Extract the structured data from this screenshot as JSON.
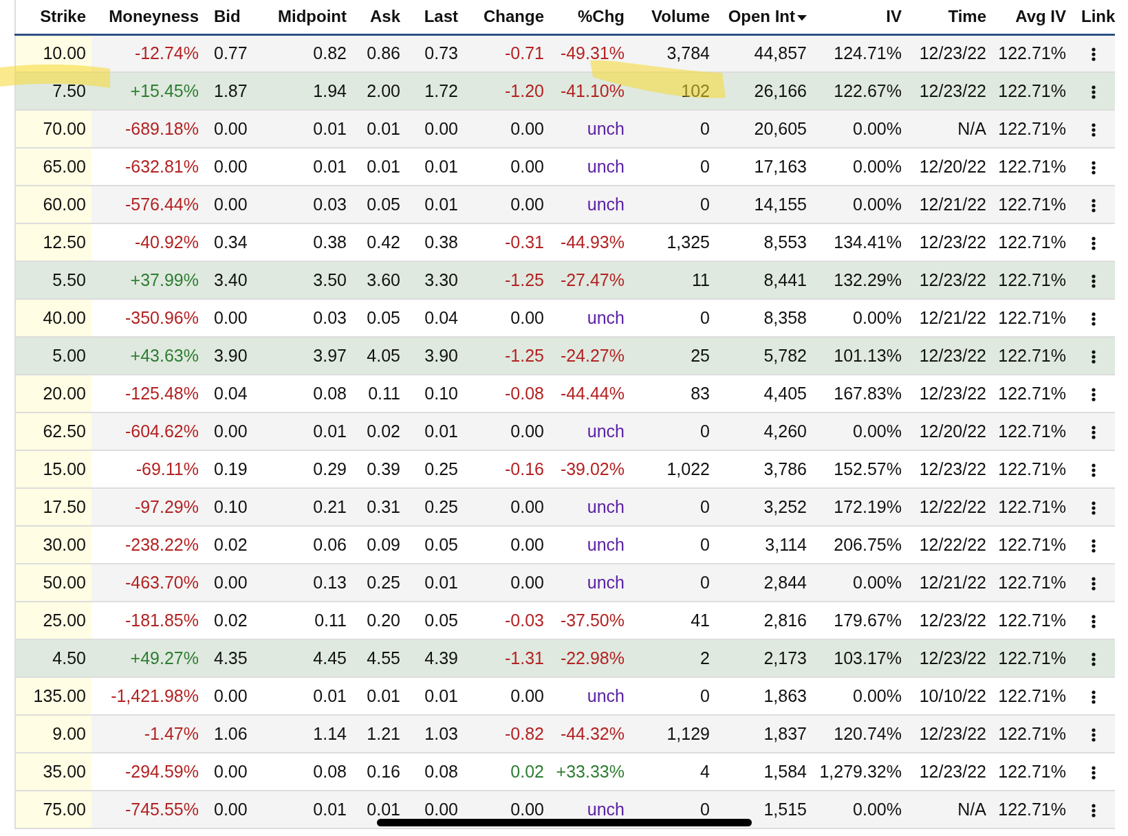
{
  "table": {
    "columns": [
      {
        "label": "Strike",
        "sorted": false
      },
      {
        "label": "Moneyness",
        "sorted": false
      },
      {
        "label": "Bid",
        "sorted": false
      },
      {
        "label": "Midpoint",
        "sorted": false
      },
      {
        "label": "Ask",
        "sorted": false
      },
      {
        "label": "Last",
        "sorted": false
      },
      {
        "label": "Change",
        "sorted": false
      },
      {
        "label": "%Chg",
        "sorted": false
      },
      {
        "label": "Volume",
        "sorted": false
      },
      {
        "label": "Open Int",
        "sorted": true
      },
      {
        "label": "IV",
        "sorted": false
      },
      {
        "label": "Time",
        "sorted": false
      },
      {
        "label": "Avg IV",
        "sorted": false
      },
      {
        "label": "Link",
        "sorted": false
      }
    ],
    "rows": [
      {
        "in_the_money": false,
        "kind": "down",
        "cells": [
          "10.00",
          "-12.74%",
          "0.77",
          "0.82",
          "0.86",
          "0.73",
          "-0.71",
          "-49.31%",
          "3,784",
          "44,857",
          "124.71%",
          "12/23/22",
          "122.71%"
        ]
      },
      {
        "in_the_money": true,
        "kind": "down",
        "cells": [
          "7.50",
          "+15.45%",
          "1.87",
          "1.94",
          "2.00",
          "1.72",
          "-1.20",
          "-41.10%",
          "102",
          "26,166",
          "122.67%",
          "12/23/22",
          "122.71%"
        ]
      },
      {
        "in_the_money": false,
        "kind": "flat",
        "cells": [
          "70.00",
          "-689.18%",
          "0.00",
          "0.01",
          "0.01",
          "0.00",
          "0.00",
          "unch",
          "0",
          "20,605",
          "0.00%",
          "N/A",
          "122.71%"
        ]
      },
      {
        "in_the_money": false,
        "kind": "flat",
        "cells": [
          "65.00",
          "-632.81%",
          "0.00",
          "0.01",
          "0.01",
          "0.01",
          "0.00",
          "unch",
          "0",
          "17,163",
          "0.00%",
          "12/20/22",
          "122.71%"
        ]
      },
      {
        "in_the_money": false,
        "kind": "flat",
        "cells": [
          "60.00",
          "-576.44%",
          "0.00",
          "0.03",
          "0.05",
          "0.01",
          "0.00",
          "unch",
          "0",
          "14,155",
          "0.00%",
          "12/21/22",
          "122.71%"
        ]
      },
      {
        "in_the_money": false,
        "kind": "down",
        "cells": [
          "12.50",
          "-40.92%",
          "0.34",
          "0.38",
          "0.42",
          "0.38",
          "-0.31",
          "-44.93%",
          "1,325",
          "8,553",
          "134.41%",
          "12/23/22",
          "122.71%"
        ]
      },
      {
        "in_the_money": true,
        "kind": "down",
        "cells": [
          "5.50",
          "+37.99%",
          "3.40",
          "3.50",
          "3.60",
          "3.30",
          "-1.25",
          "-27.47%",
          "11",
          "8,441",
          "132.29%",
          "12/23/22",
          "122.71%"
        ]
      },
      {
        "in_the_money": false,
        "kind": "flat",
        "cells": [
          "40.00",
          "-350.96%",
          "0.00",
          "0.03",
          "0.05",
          "0.04",
          "0.00",
          "unch",
          "0",
          "8,358",
          "0.00%",
          "12/21/22",
          "122.71%"
        ]
      },
      {
        "in_the_money": true,
        "kind": "down",
        "cells": [
          "5.00",
          "+43.63%",
          "3.90",
          "3.97",
          "4.05",
          "3.90",
          "-1.25",
          "-24.27%",
          "25",
          "5,782",
          "101.13%",
          "12/23/22",
          "122.71%"
        ]
      },
      {
        "in_the_money": false,
        "kind": "down",
        "cells": [
          "20.00",
          "-125.48%",
          "0.04",
          "0.08",
          "0.11",
          "0.10",
          "-0.08",
          "-44.44%",
          "83",
          "4,405",
          "167.83%",
          "12/23/22",
          "122.71%"
        ]
      },
      {
        "in_the_money": false,
        "kind": "flat",
        "cells": [
          "62.50",
          "-604.62%",
          "0.00",
          "0.01",
          "0.02",
          "0.01",
          "0.00",
          "unch",
          "0",
          "4,260",
          "0.00%",
          "12/20/22",
          "122.71%"
        ]
      },
      {
        "in_the_money": false,
        "kind": "down",
        "cells": [
          "15.00",
          "-69.11%",
          "0.19",
          "0.29",
          "0.39",
          "0.25",
          "-0.16",
          "-39.02%",
          "1,022",
          "3,786",
          "152.57%",
          "12/23/22",
          "122.71%"
        ]
      },
      {
        "in_the_money": false,
        "kind": "flat",
        "cells": [
          "17.50",
          "-97.29%",
          "0.10",
          "0.21",
          "0.31",
          "0.25",
          "0.00",
          "unch",
          "0",
          "3,252",
          "172.19%",
          "12/22/22",
          "122.71%"
        ]
      },
      {
        "in_the_money": false,
        "kind": "flat",
        "cells": [
          "30.00",
          "-238.22%",
          "0.02",
          "0.06",
          "0.09",
          "0.05",
          "0.00",
          "unch",
          "0",
          "3,114",
          "206.75%",
          "12/22/22",
          "122.71%"
        ]
      },
      {
        "in_the_money": false,
        "kind": "flat",
        "cells": [
          "50.00",
          "-463.70%",
          "0.00",
          "0.13",
          "0.25",
          "0.01",
          "0.00",
          "unch",
          "0",
          "2,844",
          "0.00%",
          "12/21/22",
          "122.71%"
        ]
      },
      {
        "in_the_money": false,
        "kind": "down",
        "cells": [
          "25.00",
          "-181.85%",
          "0.02",
          "0.11",
          "0.20",
          "0.05",
          "-0.03",
          "-37.50%",
          "41",
          "2,816",
          "179.67%",
          "12/23/22",
          "122.71%"
        ]
      },
      {
        "in_the_money": true,
        "kind": "down",
        "cells": [
          "4.50",
          "+49.27%",
          "4.35",
          "4.45",
          "4.55",
          "4.39",
          "-1.31",
          "-22.98%",
          "2",
          "2,173",
          "103.17%",
          "12/23/22",
          "122.71%"
        ]
      },
      {
        "in_the_money": false,
        "kind": "flat",
        "cells": [
          "135.00",
          "-1,421.98%",
          "0.00",
          "0.01",
          "0.01",
          "0.01",
          "0.00",
          "unch",
          "0",
          "1,863",
          "0.00%",
          "10/10/22",
          "122.71%"
        ]
      },
      {
        "in_the_money": false,
        "kind": "down",
        "cells": [
          "9.00",
          "-1.47%",
          "1.06",
          "1.14",
          "1.21",
          "1.03",
          "-0.82",
          "-44.32%",
          "1,129",
          "1,837",
          "120.74%",
          "12/23/22",
          "122.71%"
        ]
      },
      {
        "in_the_money": false,
        "kind": "up",
        "cells": [
          "35.00",
          "-294.59%",
          "0.00",
          "0.08",
          "0.16",
          "0.08",
          "0.02",
          "+33.33%",
          "4",
          "1,584",
          "1,279.32%",
          "12/23/22",
          "122.71%"
        ]
      },
      {
        "in_the_money": false,
        "kind": "flat",
        "cells": [
          "75.00",
          "-745.55%",
          "0.00",
          "0.01",
          "0.01",
          "0.00",
          "0.00",
          "unch",
          "0",
          "1,515",
          "0.00%",
          "N/A",
          "122.71%"
        ]
      }
    ]
  }
}
